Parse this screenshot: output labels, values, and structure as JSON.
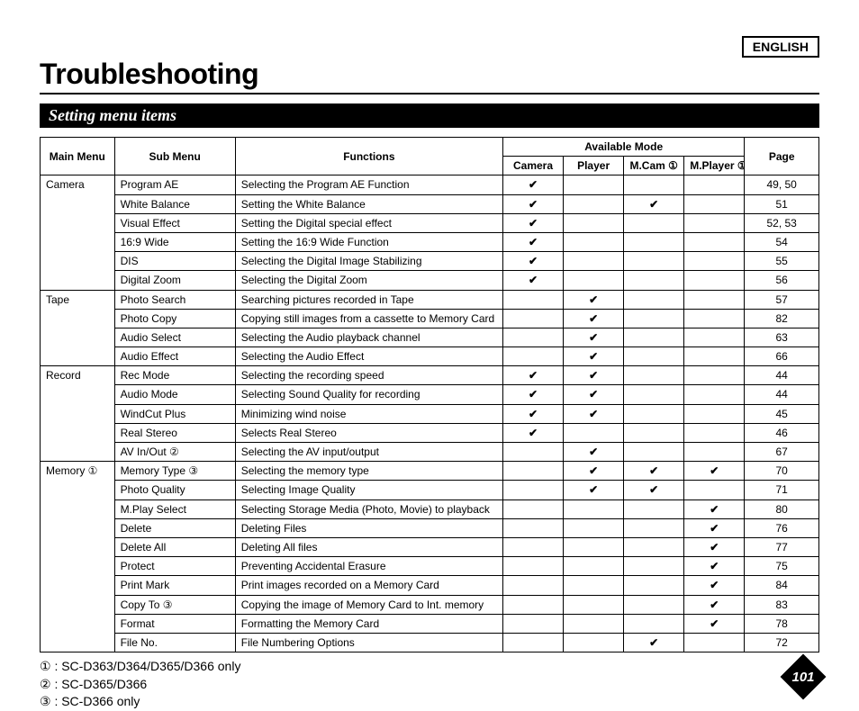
{
  "lang": "ENGLISH",
  "title": "Troubleshooting",
  "section": "Setting menu items",
  "headers": {
    "main": "Main Menu",
    "sub": "Sub Menu",
    "func": "Functions",
    "avail": "Available Mode",
    "camera": "Camera",
    "player": "Player",
    "mcam": "M.Cam ①",
    "mplayer": "M.Player ①",
    "page": "Page"
  },
  "chart_data": {
    "type": "table",
    "columns": [
      "Main Menu",
      "Sub Menu",
      "Functions",
      "Camera",
      "Player",
      "M.Cam ①",
      "M.Player ①",
      "Page"
    ],
    "groups": [
      {
        "main": "Camera",
        "rows": [
          {
            "sub": "Program AE",
            "func": "Selecting the Program AE Function",
            "m": [
              true,
              false,
              false,
              false
            ],
            "page": "49, 50"
          },
          {
            "sub": "White Balance",
            "func": "Setting the White Balance",
            "m": [
              true,
              false,
              true,
              false
            ],
            "page": "51"
          },
          {
            "sub": "Visual Effect",
            "func": "Setting the Digital special effect",
            "m": [
              true,
              false,
              false,
              false
            ],
            "page": "52, 53"
          },
          {
            "sub": "16:9 Wide",
            "func": "Setting the 16:9 Wide Function",
            "m": [
              true,
              false,
              false,
              false
            ],
            "page": "54"
          },
          {
            "sub": "DIS",
            "func": "Selecting the Digital Image Stabilizing",
            "m": [
              true,
              false,
              false,
              false
            ],
            "page": "55"
          },
          {
            "sub": "Digital Zoom",
            "func": "Selecting the Digital Zoom",
            "m": [
              true,
              false,
              false,
              false
            ],
            "page": "56"
          }
        ]
      },
      {
        "main": "Tape",
        "rows": [
          {
            "sub": "Photo Search",
            "func": "Searching pictures recorded in Tape",
            "m": [
              false,
              true,
              false,
              false
            ],
            "page": "57"
          },
          {
            "sub": "Photo Copy",
            "func": "Copying still images from a cassette to Memory Card",
            "m": [
              false,
              true,
              false,
              false
            ],
            "page": "82"
          },
          {
            "sub": "Audio Select",
            "func": "Selecting the Audio playback channel",
            "m": [
              false,
              true,
              false,
              false
            ],
            "page": "63"
          },
          {
            "sub": "Audio Effect",
            "func": "Selecting the Audio Effect",
            "m": [
              false,
              true,
              false,
              false
            ],
            "page": "66"
          }
        ]
      },
      {
        "main": "Record",
        "rows": [
          {
            "sub": "Rec Mode",
            "func": "Selecting the recording speed",
            "m": [
              true,
              true,
              false,
              false
            ],
            "page": "44"
          },
          {
            "sub": "Audio Mode",
            "func": "Selecting Sound Quality for recording",
            "m": [
              true,
              true,
              false,
              false
            ],
            "page": "44"
          },
          {
            "sub": "WindCut Plus",
            "func": "Minimizing wind noise",
            "m": [
              true,
              true,
              false,
              false
            ],
            "page": "45"
          },
          {
            "sub": "Real Stereo",
            "func": "Selects Real Stereo",
            "m": [
              true,
              false,
              false,
              false
            ],
            "page": "46"
          },
          {
            "sub": "AV In/Out ②",
            "func": "Selecting the AV input/output",
            "m": [
              false,
              true,
              false,
              false
            ],
            "page": "67"
          }
        ]
      },
      {
        "main": "Memory ①",
        "rows": [
          {
            "sub": "Memory Type ③",
            "func": "Selecting the memory type",
            "m": [
              false,
              true,
              true,
              true
            ],
            "page": "70"
          },
          {
            "sub": "Photo Quality",
            "func": "Selecting Image Quality",
            "m": [
              false,
              true,
              true,
              false
            ],
            "page": "71"
          },
          {
            "sub": "M.Play Select",
            "func": "Selecting Storage Media (Photo, Movie) to playback",
            "m": [
              false,
              false,
              false,
              true
            ],
            "page": "80"
          },
          {
            "sub": "Delete",
            "func": "Deleting Files",
            "m": [
              false,
              false,
              false,
              true
            ],
            "page": "76"
          },
          {
            "sub": "Delete All",
            "func": "Deleting All files",
            "m": [
              false,
              false,
              false,
              true
            ],
            "page": "77"
          },
          {
            "sub": "Protect",
            "func": "Preventing Accidental Erasure",
            "m": [
              false,
              false,
              false,
              true
            ],
            "page": "75"
          },
          {
            "sub": "Print Mark",
            "func": "Print images recorded on a Memory Card",
            "m": [
              false,
              false,
              false,
              true
            ],
            "page": "84"
          },
          {
            "sub": "Copy To ③",
            "func": "Copying the image of Memory Card to Int. memory",
            "m": [
              false,
              false,
              false,
              true
            ],
            "page": "83"
          },
          {
            "sub": "Format",
            "func": "Formatting the Memory Card",
            "m": [
              false,
              false,
              false,
              true
            ],
            "page": "78"
          },
          {
            "sub": "File No.",
            "func": "File Numbering Options",
            "m": [
              false,
              false,
              true,
              false
            ],
            "page": "72"
          }
        ]
      }
    ]
  },
  "footnotes": [
    "① : SC-D363/D364/D365/D366 only",
    "② : SC-D365/D366",
    "③ : SC-D366 only"
  ],
  "pagenum": "101",
  "check": "✔"
}
